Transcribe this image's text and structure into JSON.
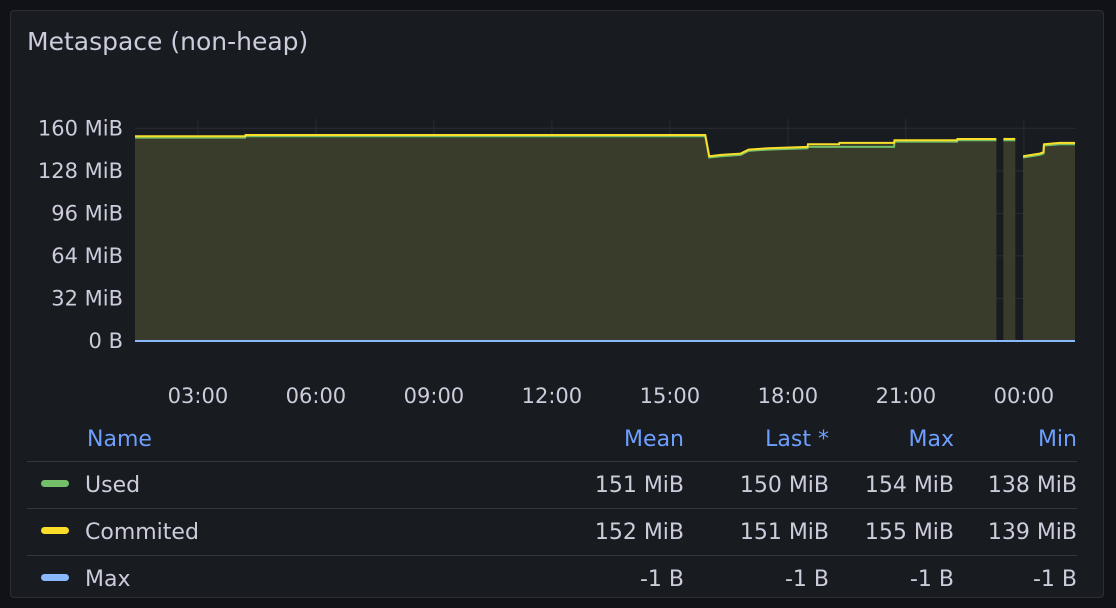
{
  "panel": {
    "title": "Metaspace (non-heap)"
  },
  "legend": {
    "headers": {
      "name": "Name",
      "mean": "Mean",
      "last": "Last *",
      "max": "Max",
      "min": "Min"
    },
    "rows": [
      {
        "name": "Used",
        "color": "#73bf69",
        "mean": "151 MiB",
        "last": "150 MiB",
        "max": "154 MiB",
        "min": "138 MiB"
      },
      {
        "name": "Commited",
        "color": "#fade2a",
        "mean": "152 MiB",
        "last": "151 MiB",
        "max": "155 MiB",
        "min": "139 MiB"
      },
      {
        "name": "Max",
        "color": "#8ab8ff",
        "mean": "-1 B",
        "last": "-1 B",
        "max": "-1 B",
        "min": "-1 B"
      }
    ]
  },
  "chart_data": {
    "type": "area",
    "x_unit": "hours",
    "xlim": [
      1.4,
      25.3
    ],
    "ylim": [
      0,
      167
    ],
    "y_ticks": [
      {
        "value": 0,
        "label": "0 B"
      },
      {
        "value": 32,
        "label": "32 MiB"
      },
      {
        "value": 64,
        "label": "64 MiB"
      },
      {
        "value": 96,
        "label": "96 MiB"
      },
      {
        "value": 128,
        "label": "128 MiB"
      },
      {
        "value": 160,
        "label": "160 MiB"
      }
    ],
    "x_ticks": [
      {
        "value": 3,
        "label": "03:00"
      },
      {
        "value": 6,
        "label": "06:00"
      },
      {
        "value": 9,
        "label": "09:00"
      },
      {
        "value": 12,
        "label": "12:00"
      },
      {
        "value": 15,
        "label": "15:00"
      },
      {
        "value": 18,
        "label": "18:00"
      },
      {
        "value": 21,
        "label": "21:00"
      },
      {
        "value": 24,
        "label": "00:00"
      }
    ],
    "grid": true,
    "legend_placement": "bottom",
    "series": [
      {
        "name": "Commited",
        "color": "#fade2a",
        "fill": "#3a3c2b",
        "segments": [
          [
            [
              1.4,
              154
            ],
            [
              4.2,
              154
            ],
            [
              4.21,
              155
            ],
            [
              15.9,
              155
            ],
            [
              16.0,
              139
            ],
            [
              16.3,
              140
            ],
            [
              16.8,
              141
            ],
            [
              17.0,
              144
            ],
            [
              17.5,
              145
            ],
            [
              18.5,
              146
            ],
            [
              18.51,
              148
            ],
            [
              19.3,
              148
            ],
            [
              19.31,
              149
            ],
            [
              20.7,
              149
            ],
            [
              20.71,
              151
            ],
            [
              22.3,
              151
            ],
            [
              22.31,
              152
            ],
            [
              23.3,
              152
            ]
          ],
          [
            [
              23.48,
              152
            ],
            [
              23.78,
              152
            ]
          ],
          [
            [
              23.98,
              139
            ],
            [
              24.4,
              141
            ],
            [
              24.5,
              142
            ],
            [
              24.51,
              148
            ],
            [
              24.9,
              149
            ],
            [
              25.3,
              149
            ]
          ]
        ]
      },
      {
        "name": "Used",
        "color": "#73bf69",
        "fill": "#3a3c2b",
        "segments": [
          [
            [
              1.4,
              153
            ],
            [
              4.2,
              153
            ],
            [
              4.21,
              154
            ],
            [
              15.9,
              154
            ],
            [
              16.0,
              138
            ],
            [
              16.3,
              139
            ],
            [
              16.8,
              140
            ],
            [
              17.0,
              143
            ],
            [
              17.5,
              144
            ],
            [
              18.5,
              145
            ],
            [
              18.51,
              146
            ],
            [
              20.7,
              146
            ],
            [
              20.71,
              150
            ],
            [
              22.3,
              150
            ],
            [
              22.31,
              151
            ],
            [
              23.3,
              151
            ]
          ],
          [
            [
              23.48,
              151
            ],
            [
              23.78,
              151
            ]
          ],
          [
            [
              23.98,
              138
            ],
            [
              24.4,
              140
            ],
            [
              24.5,
              141
            ],
            [
              24.51,
              147
            ],
            [
              24.9,
              148
            ],
            [
              25.3,
              148
            ]
          ]
        ]
      },
      {
        "name": "Max",
        "color": "#8ab8ff",
        "segments": [
          [
            [
              1.4,
              0
            ],
            [
              25.3,
              0
            ]
          ]
        ]
      }
    ]
  }
}
